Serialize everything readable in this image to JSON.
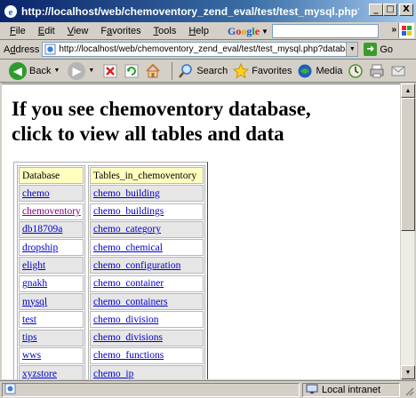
{
  "window": {
    "title": "http://localhost/web/chemoventory_zend_eval/test/test_mysql.php?databas...",
    "buttons": {
      "minimize": "_",
      "maximize": "□",
      "close": "X"
    }
  },
  "menu": {
    "items": [
      {
        "key": "F",
        "rest": "ile"
      },
      {
        "key": "E",
        "rest": "dit"
      },
      {
        "key": "V",
        "rest": "iew"
      },
      {
        "key": "",
        "pre": "F",
        "key2": "a",
        "rest": "vorites"
      },
      {
        "key": "T",
        "rest": "ools"
      },
      {
        "key": "H",
        "rest": "elp"
      }
    ],
    "google_label": "Google",
    "more_glyph": "»"
  },
  "address": {
    "label_key": "d",
    "label_pre": "A",
    "label_rest": "dress",
    "url": "http://localhost/web/chemoventory_zend_eval/test/test_mysql.php?database=chem",
    "go_label": "Go"
  },
  "toolbar": {
    "back_label": "Back",
    "search_label": "Search",
    "favorites_label": "Favorites",
    "media_label": "Media"
  },
  "page": {
    "heading_line1": "If you see chemoventory database,",
    "heading_line2": "click to view all tables and data",
    "db_header": "Database",
    "tables_header": "Tables_in_chemoventory",
    "databases": [
      "chemo",
      "chemoventory",
      "db18709a",
      "dropship",
      "elight",
      "gnakh",
      "mysql",
      "test",
      "tips",
      "wws",
      "xyzstore"
    ],
    "tables": [
      "chemo_building",
      "chemo_buildings",
      "chemo_category",
      "chemo_chemical",
      "chemo_configuration",
      "chemo_container",
      "chemo_containers",
      "chemo_division",
      "chemo_divisions",
      "chemo_functions",
      "chemo_ip"
    ]
  },
  "status": {
    "zone_label": "Local intranet"
  },
  "colors": {
    "title_gradient_start": "#0a246a",
    "link": "#0000cc",
    "visited_link": "#800080",
    "header_cell": "#ffffc0"
  }
}
